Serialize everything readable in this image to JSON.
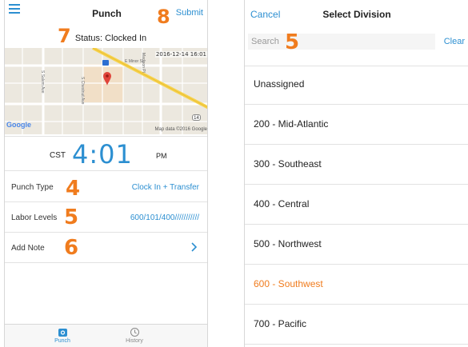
{
  "colors": {
    "accent": "#2c8fd1",
    "callout": "#f07c1e",
    "selected": "#f07c1e"
  },
  "punch_screen": {
    "title": "Punch",
    "submit_label": "Submit",
    "status": "Status: Clocked In",
    "map": {
      "timestamp": "2016-12-14 16:01",
      "google_label": "Google",
      "credit": "Map data ©2016 Google",
      "route_number": "14",
      "street_labels": [
        "E Minor St",
        "S Salem Ave",
        "S Chestnut Ave",
        "Madison Pl"
      ]
    },
    "clock": {
      "timezone": "CST",
      "time": "4:01",
      "ampm": "PM"
    },
    "rows": [
      {
        "label": "Punch Type",
        "value": "Clock In + Transfer"
      },
      {
        "label": "Labor Levels",
        "value": "600/101/400///////////"
      },
      {
        "label": "Add Note",
        "value": ""
      }
    ],
    "tabs": [
      {
        "label": "Punch",
        "icon": "punch-icon",
        "active": true
      },
      {
        "label": "History",
        "icon": "history-icon",
        "active": false
      }
    ]
  },
  "division_screen": {
    "cancel_label": "Cancel",
    "title": "Select Division",
    "search_placeholder": "Search",
    "clear_label": "Clear",
    "items": [
      {
        "label": "Unassigned",
        "selected": false
      },
      {
        "label": "200 - Mid-Atlantic",
        "selected": false
      },
      {
        "label": "300 - Southeast",
        "selected": false
      },
      {
        "label": "400 - Central",
        "selected": false
      },
      {
        "label": "500 - Northwest",
        "selected": false
      },
      {
        "label": "600 - Southwest",
        "selected": true
      },
      {
        "label": "700 - Pacific",
        "selected": false
      }
    ]
  },
  "callouts": {
    "n4": "4",
    "n5_left": "5",
    "n5_right": "5",
    "n6": "6",
    "n7": "7",
    "n8": "8"
  }
}
